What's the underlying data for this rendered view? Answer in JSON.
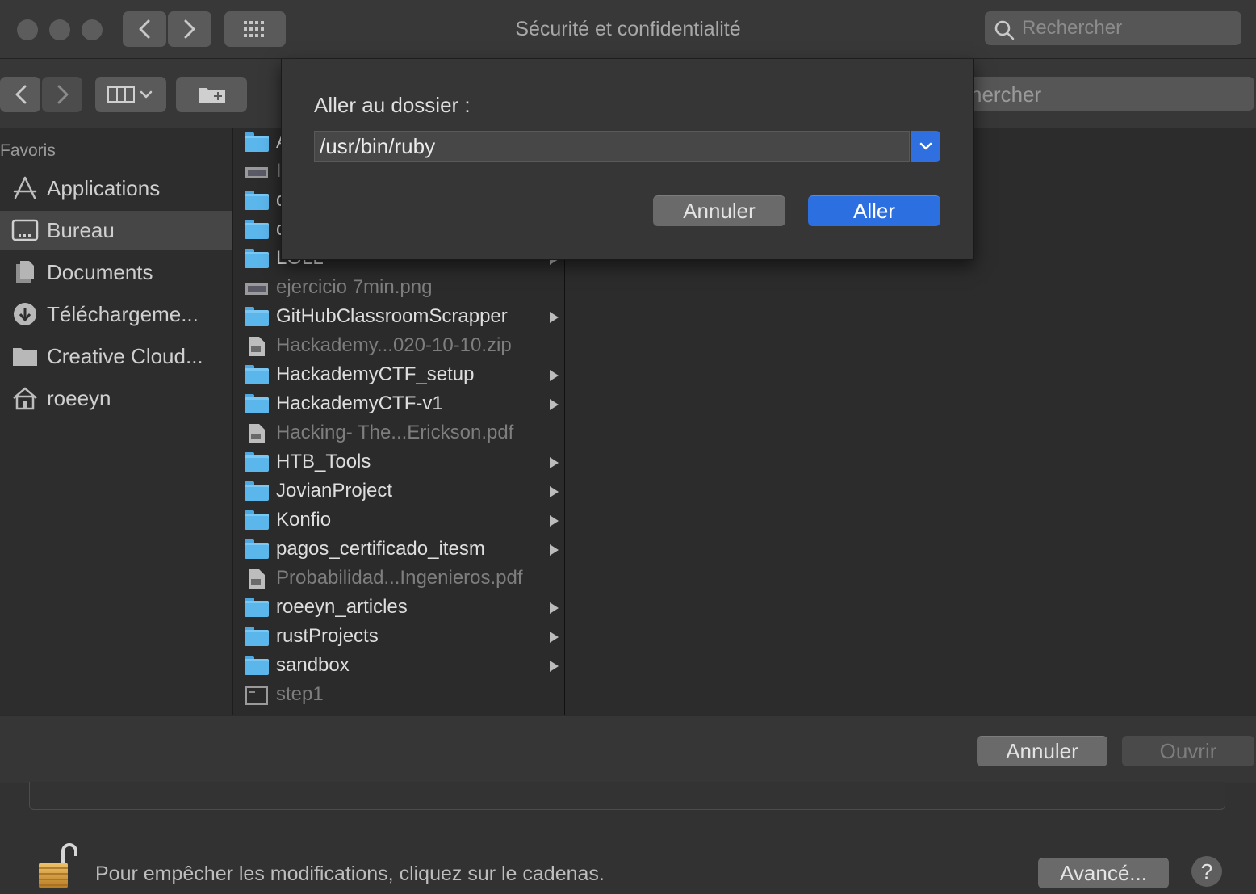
{
  "window": {
    "title": "Sécurité et confidentialité",
    "search_placeholder": "Rechercher"
  },
  "panel": {
    "search_partial": "hercher",
    "sidebar": {
      "heading": "Favoris",
      "items": [
        {
          "label": "Applications",
          "icon": "applications-icon"
        },
        {
          "label": "Bureau",
          "icon": "desktop-icon",
          "selected": true
        },
        {
          "label": "Documents",
          "icon": "documents-icon"
        },
        {
          "label": "Téléchargeme...",
          "icon": "downloads-icon"
        },
        {
          "label": "Creative Cloud...",
          "icon": "folder-icon"
        },
        {
          "label": "roeeyn",
          "icon": "home-icon"
        }
      ]
    },
    "files": [
      {
        "label": "A",
        "type": "folder",
        "arrow": false,
        "dim": false
      },
      {
        "label": "I",
        "type": "image",
        "arrow": false,
        "dim": true
      },
      {
        "label": "c",
        "type": "folder",
        "arrow": false,
        "dim": false
      },
      {
        "label": "c",
        "type": "folder",
        "arrow": false,
        "dim": false
      },
      {
        "label": "LOLL",
        "type": "folder",
        "arrow": true,
        "dim": false
      },
      {
        "label": "ejercicio 7min.png",
        "type": "image",
        "arrow": false,
        "dim": true
      },
      {
        "label": "GitHubClassroomScrapper",
        "type": "folder",
        "arrow": true,
        "dim": false
      },
      {
        "label": "Hackademy...020-10-10.zip",
        "type": "zip",
        "arrow": false,
        "dim": true
      },
      {
        "label": "HackademyCTF_setup",
        "type": "folder",
        "arrow": true,
        "dim": false
      },
      {
        "label": "HackademyCTF-v1",
        "type": "folder",
        "arrow": true,
        "dim": false
      },
      {
        "label": "Hacking- The...Erickson.pdf",
        "type": "pdf",
        "arrow": false,
        "dim": true
      },
      {
        "label": "HTB_Tools",
        "type": "folder",
        "arrow": true,
        "dim": false
      },
      {
        "label": "JovianProject",
        "type": "folder",
        "arrow": true,
        "dim": false
      },
      {
        "label": "Konfio",
        "type": "folder",
        "arrow": true,
        "dim": false
      },
      {
        "label": "pagos_certificado_itesm",
        "type": "folder",
        "arrow": true,
        "dim": false
      },
      {
        "label": "Probabilidad...Ingenieros.pdf",
        "type": "pdf",
        "arrow": false,
        "dim": true
      },
      {
        "label": "roeeyn_articles",
        "type": "folder",
        "arrow": true,
        "dim": false
      },
      {
        "label": "rustProjects",
        "type": "folder",
        "arrow": true,
        "dim": false
      },
      {
        "label": "sandbox",
        "type": "folder",
        "arrow": true,
        "dim": false
      },
      {
        "label": "step1",
        "type": "exec",
        "arrow": false,
        "dim": true
      }
    ],
    "footer": {
      "cancel_label": "Annuler",
      "open_label": "Ouvrir"
    }
  },
  "goto_sheet": {
    "title": "Aller au dossier :",
    "path_value": "/usr/bin/ruby",
    "cancel_label": "Annuler",
    "go_label": "Aller"
  },
  "prefs": {
    "lock_text": "Pour empêcher les modifications, cliquez sur le cadenas.",
    "advanced_label": "Avancé...",
    "help_label": "?"
  },
  "colors": {
    "accent": "#2b6fe0",
    "folder": "#5bb6ec"
  }
}
